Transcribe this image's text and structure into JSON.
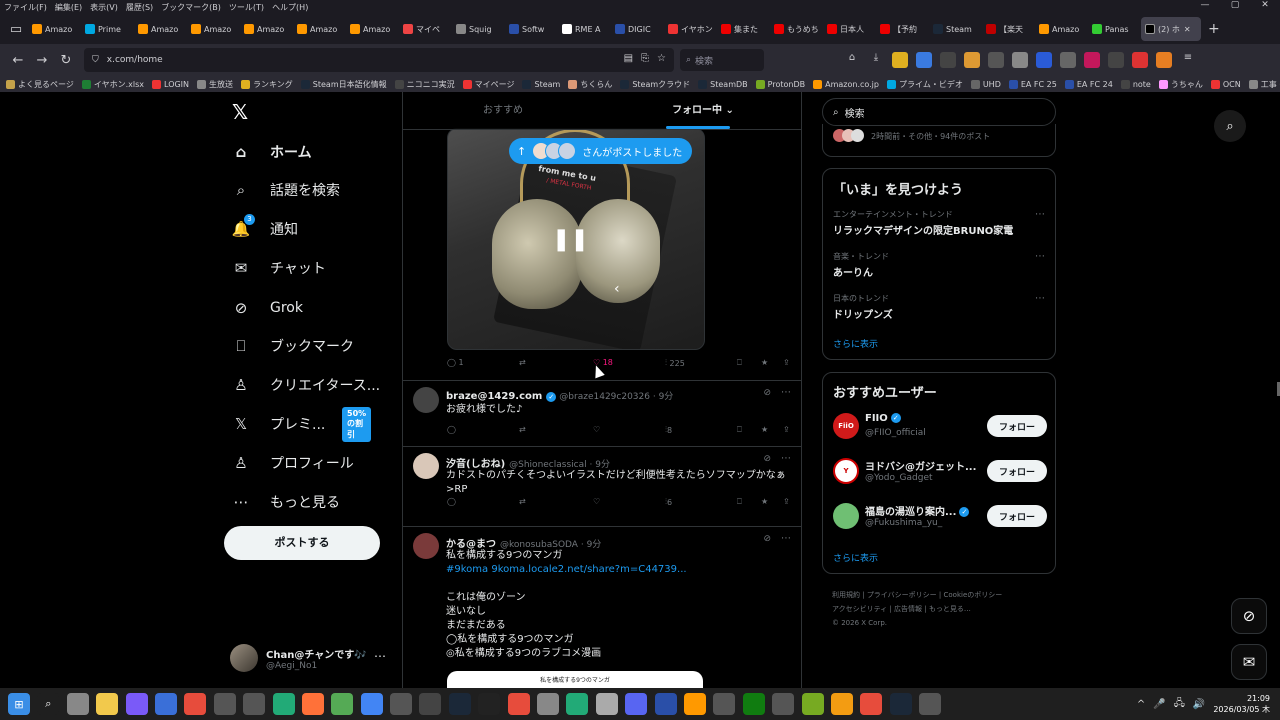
{
  "browser": {
    "menu": [
      "ファイル(F)",
      "編集(E)",
      "表示(V)",
      "履歴(S)",
      "ブックマーク(B)",
      "ツール(T)",
      "ヘルプ(H)"
    ],
    "tabs": [
      {
        "label": "Amazo",
        "color": "#ff9900"
      },
      {
        "label": "Prime",
        "color": "#00a8e1"
      },
      {
        "label": "Amazo",
        "color": "#ff9900"
      },
      {
        "label": "Amazo",
        "color": "#ff9900"
      },
      {
        "label": "Amazo",
        "color": "#ff9900"
      },
      {
        "label": "Amazo",
        "color": "#ff9900"
      },
      {
        "label": "Amazo",
        "color": "#ff9900"
      },
      {
        "label": "マイペ",
        "color": "#e44"
      },
      {
        "label": "Squig",
        "color": "#888"
      },
      {
        "label": "Softw",
        "color": "#2a4fa8"
      },
      {
        "label": "RME A",
        "color": "#fff"
      },
      {
        "label": "DIGIC",
        "color": "#2a4fa8"
      },
      {
        "label": "イヤホン",
        "color": "#e33"
      },
      {
        "label": "集また",
        "color": "#e00"
      },
      {
        "label": "もうめち",
        "color": "#e00"
      },
      {
        "label": "日本人",
        "color": "#e00"
      },
      {
        "label": "【予約",
        "color": "#e00"
      },
      {
        "label": "Steam",
        "color": "#1b2838"
      },
      {
        "label": "【楽天",
        "color": "#bf0000"
      },
      {
        "label": "Amazo",
        "color": "#ff9900"
      },
      {
        "label": "Panas",
        "color": "#3c3"
      }
    ],
    "active_tab": "(2) ホ",
    "new_tab": "+",
    "url": "x.com/home",
    "search_placeholder": "検索",
    "win_controls": [
      "—",
      "▢",
      "✕"
    ],
    "bookmarks": [
      "よく見るページ",
      "イヤホン.xlsx",
      "LOGIN",
      "生放送",
      "ランキング",
      "Steam日本語化情報",
      "ニコニコ実況",
      "マイページ",
      "Steam",
      "ちくらん",
      "Steamクラウド",
      "SteamDB",
      "ProtonDB",
      "Amazon.co.jp",
      "プライム・ビデオ",
      "UHD",
      "EA FC 25",
      "EA FC 24",
      "note",
      "うちゃん",
      "OCN",
      "工事・設備一覧 | NTT"
    ]
  },
  "nav": {
    "items": [
      {
        "label": "ホーム",
        "icon": "home-icon",
        "glyph": "⌂"
      },
      {
        "label": "話題を検索",
        "icon": "search-icon",
        "glyph": "⌕"
      },
      {
        "label": "通知",
        "icon": "bell-icon",
        "glyph": "🔔",
        "badge": "3"
      },
      {
        "label": "チャット",
        "icon": "mail-icon",
        "glyph": "✉"
      },
      {
        "label": "Grok",
        "icon": "grok-icon",
        "glyph": "⊘"
      },
      {
        "label": "ブックマーク",
        "icon": "bookmark-icon",
        "glyph": "⎕"
      },
      {
        "label": "クリエイタース...",
        "icon": "creator-icon",
        "glyph": "♙"
      },
      {
        "label": "プレミ...",
        "icon": "premium-icon",
        "glyph": "𝕏",
        "tag": "50%の割引"
      },
      {
        "label": "プロフィール",
        "icon": "profile-icon",
        "glyph": "♙"
      },
      {
        "label": "もっと見る",
        "icon": "more-icon",
        "glyph": "⋯"
      }
    ],
    "post_button": "ポストする",
    "account": {
      "name": "Chan@チャンです🎶",
      "handle": "@Aegi_No1"
    }
  },
  "timeline": {
    "tabs": [
      "おすすめ",
      "フォロー中"
    ],
    "posted_pill": "さんがポストしました",
    "media": {
      "line1": "from me to u",
      "line2": "/ METAL FORTH"
    },
    "first_post_stats": {
      "replies": "1",
      "likes": "18",
      "views": "225"
    },
    "tweets": [
      {
        "name": "braze@1429.com",
        "handle": "@braze1429c20326",
        "time": "9分",
        "verified": true,
        "text": "お疲れ様でした♪",
        "views": "8",
        "avatar": "#444"
      },
      {
        "name": "汐音(しおね)",
        "handle": "@Shioneclassical",
        "time": "9分",
        "verified": false,
        "text": "カドストのパチくそつよいイラストだけど利便性考えたらソフマップかなぁ\n>RP",
        "views": "6",
        "avatar": "#d9c7b8"
      },
      {
        "name": "かる@まつ",
        "handle": "@konosubaSODA",
        "time": "9分",
        "verified": false,
        "text": "私を構成する9つのマンガ",
        "link": "#9koma 9koma.locale2.net/share?m=C44739...",
        "lines": [
          "これは俺のゾーン",
          "迷いなし",
          "まだまだある",
          "◯私を構成する9つのマンガ",
          "◎私を構成する9つのラブコメ漫画"
        ],
        "avatar": "#7a3a3a",
        "image_caption": "私を構成する9つのマンガ"
      }
    ]
  },
  "right": {
    "search_placeholder": "検索",
    "recap": "2時間前・その他・94件のポスト",
    "trends_title": "「いま」を見つけよう",
    "trends": [
      {
        "category": "エンターテインメント・トレンド",
        "name": "リラックマデザインの限定BRUNO家電"
      },
      {
        "category": "音楽・トレンド",
        "name": "あーりん"
      },
      {
        "category": "日本のトレンド",
        "name": "ドリップンズ"
      }
    ],
    "show_more": "さらに表示",
    "who_title": "おすすめユーザー",
    "users": [
      {
        "name": "FIIO",
        "handle": "@FIIO_official",
        "verified": true,
        "color": "#d01a1a",
        "initials": "FiiO"
      },
      {
        "name": "ヨドバシ@ガジェット...",
        "handle": "@Yodo_Gadget",
        "verified": false,
        "color": "#ffffff",
        "initials": "Y"
      },
      {
        "name": "福島の湯巡り案内...",
        "handle": "@Fukushima_yu_",
        "verified": true,
        "color": "#6fbf73",
        "initials": ""
      }
    ],
    "follow_label": "フォロー",
    "footer": [
      "利用規約",
      "プライバシーポリシー",
      "Cookieのポリシー",
      "アクセシビリティ",
      "広告情報",
      "もっと見る…",
      "© 2026 X Corp."
    ]
  },
  "taskbar": {
    "time": "21:09",
    "date": "2026/03/05 木",
    "tray": [
      "^",
      "🎤",
      "🖧",
      "🔊"
    ]
  }
}
